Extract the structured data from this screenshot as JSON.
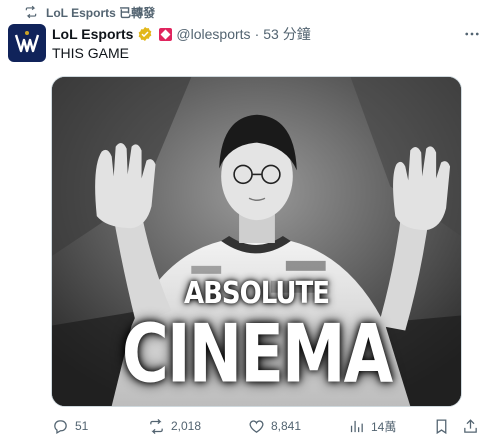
{
  "repost_banner": {
    "text": "LoL Esports 已轉發",
    "icon": "repost-icon"
  },
  "author": {
    "avatar_icon": "worlds-logo-icon",
    "name": "LoL Esports",
    "handle": "@lolesports",
    "separator": "·",
    "time": "53 分鐘",
    "verified_badge": "verified-badge-icon",
    "affiliate_badge": "affiliate-badge-icon",
    "brand_color": "#e0245e",
    "verified_color": "#e2b719"
  },
  "tweet": {
    "text": "THIS GAME"
  },
  "media": {
    "caption_top": "ABSOLUTE",
    "caption_bottom": "CINEMA"
  },
  "actions": {
    "replies": "51",
    "reposts": "2,018",
    "likes": "8,841",
    "views": "14萬"
  }
}
